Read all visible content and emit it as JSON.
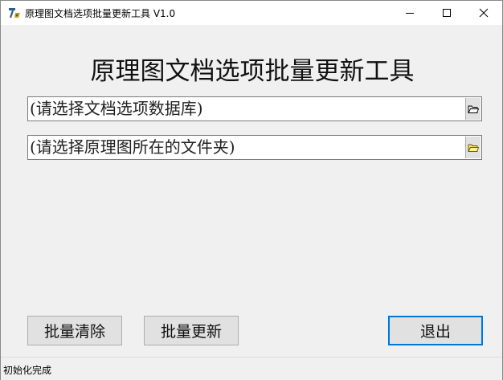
{
  "window": {
    "title": "原理图文档选项批量更新工具 V1.0"
  },
  "main": {
    "heading": "原理图文档选项批量更新工具",
    "database_field": {
      "value": "(请选择文档选项数据库)",
      "browse_icon": "open-folder-icon"
    },
    "folder_field": {
      "value": "(请选择原理图所在的文件夹)",
      "browse_icon": "folder-icon"
    }
  },
  "buttons": {
    "batch_clear": "批量清除",
    "batch_update": "批量更新",
    "exit": "退出"
  },
  "status": {
    "text": "初始化完成"
  },
  "colors": {
    "accent": "#0078d7",
    "window_bg": "#f0f0f0",
    "button_bg": "#e1e1e1"
  }
}
